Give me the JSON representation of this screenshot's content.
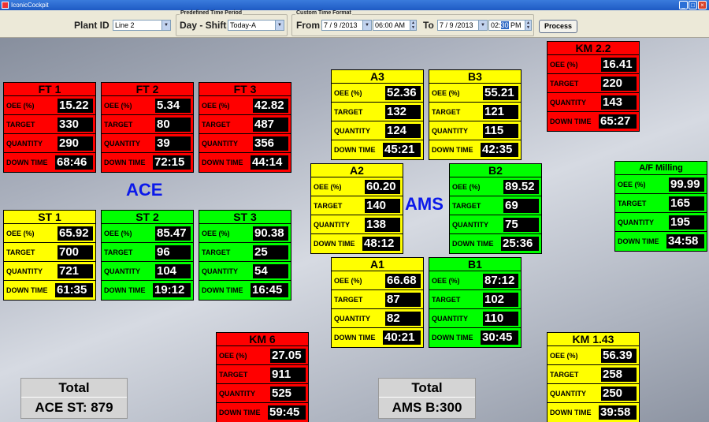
{
  "window": {
    "title": "IconicCockpit",
    "btn_min": "_",
    "btn_max": "□",
    "btn_close": "×"
  },
  "toolbar": {
    "plant_label": "Plant ID",
    "plant_value": "Line 2",
    "predef_group": "Predefined Time Period",
    "shift_label": "Day - Shift",
    "shift_value": "Today-A",
    "custom_group": "Custom Time Format",
    "from_label": "From",
    "from_date": "7 / 9 /2013",
    "from_time": "06:00 AM",
    "to_label": "To",
    "to_date": "7 / 9 /2013",
    "to_time_hh": "02:",
    "to_time_mm": "30",
    "to_time_ampm": "PM",
    "process_label": "Process"
  },
  "sections": {
    "ace": "ACE",
    "ams": "AMS"
  },
  "row_labels": {
    "oee": "OEE (%)",
    "target": "TARGET",
    "quantity": "QUANTITY",
    "downtime": "DOWN TIME"
  },
  "panels": {
    "ft1": {
      "title": "FT 1",
      "oee": "15.22",
      "target": "330",
      "quantity": "290",
      "downtime": "68:46",
      "color": "#ff0000"
    },
    "ft2": {
      "title": "FT 2",
      "oee": "5.34",
      "target": "80",
      "quantity": "39",
      "downtime": "72:15",
      "color": "#ff0000"
    },
    "ft3": {
      "title": "FT 3",
      "oee": "42.82",
      "target": "487",
      "quantity": "356",
      "downtime": "44:14",
      "color": "#ff0000"
    },
    "st1": {
      "title": "ST 1",
      "oee": "65.92",
      "target": "700",
      "quantity": "721",
      "downtime": "61:35",
      "color": "#ffff00"
    },
    "st2": {
      "title": "ST 2",
      "oee": "85.47",
      "target": "96",
      "quantity": "104",
      "downtime": "19:12",
      "color": "#00ff00"
    },
    "st3": {
      "title": "ST 3",
      "oee": "90.38",
      "target": "25",
      "quantity": "54",
      "downtime": "16:45",
      "color": "#00ff00"
    },
    "a3": {
      "title": "A3",
      "oee": "52.36",
      "target": "132",
      "quantity": "124",
      "downtime": "45:21",
      "color": "#ffff00"
    },
    "b3": {
      "title": "B3",
      "oee": "55.21",
      "target": "121",
      "quantity": "115",
      "downtime": "42:35",
      "color": "#ffff00"
    },
    "a2": {
      "title": "A2",
      "oee": "60.20",
      "target": "140",
      "quantity": "138",
      "downtime": "48:12",
      "color": "#ffff00"
    },
    "b2": {
      "title": "B2",
      "oee": "89.52",
      "target": "69",
      "quantity": "75",
      "downtime": "25:36",
      "color": "#00ff00"
    },
    "a1": {
      "title": "A1",
      "oee": "66.68",
      "target": "87",
      "quantity": "82",
      "downtime": "40:21",
      "color": "#ffff00"
    },
    "b1": {
      "title": "B1",
      "oee": "87:12",
      "target": "102",
      "quantity": "110",
      "downtime": "30:45",
      "color": "#00ff00"
    },
    "km22": {
      "title": "KM 2.2",
      "oee": "16.41",
      "target": "220",
      "quantity": "143",
      "downtime": "65:27",
      "color": "#ff0000"
    },
    "afmill": {
      "title": "A/F Milling",
      "oee": "99.99",
      "target": "165",
      "quantity": "195",
      "downtime": "34:58",
      "color": "#00ff00"
    },
    "km6": {
      "title": "KM 6",
      "oee": "27.05",
      "target": "911",
      "quantity": "525",
      "downtime": "59:45",
      "color": "#ff0000"
    },
    "km143": {
      "title": "KM 1.43",
      "oee": "56.39",
      "target": "258",
      "quantity": "250",
      "downtime": "39:58",
      "color": "#ffff00"
    }
  },
  "totals": {
    "ace": {
      "heading": "Total",
      "value": "ACE ST: 879"
    },
    "ams": {
      "heading": "Total",
      "value": "AMS B:300"
    }
  }
}
